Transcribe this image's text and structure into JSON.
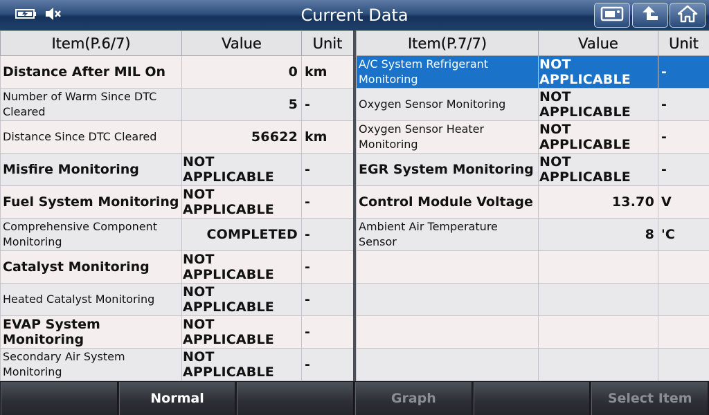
{
  "title": "Current Data",
  "icons": {
    "battery": "battery-icon",
    "speaker": "speaker-mute-icon",
    "snapshot": "snapshot-icon",
    "back": "back-arrow-icon",
    "home": "home-icon"
  },
  "colors": {
    "titlebar": "#2f4f7c",
    "selected_row": "#1a73c8",
    "row_odd": "#f5eeee",
    "row_even": "#e9e9eb"
  },
  "left_table": {
    "headers": {
      "item": "Item(P.6/7)",
      "value": "Value",
      "unit": "Unit"
    },
    "rows": [
      {
        "item": "Distance After MIL On",
        "value": "0",
        "unit": "km"
      },
      {
        "item": "Number of Warm Since DTC Cleared",
        "value": "5",
        "unit": "-"
      },
      {
        "item": "Distance Since DTC Cleared",
        "value": "56622",
        "unit": "km"
      },
      {
        "item": "Misfire Monitoring",
        "value": "NOT APPLICABLE",
        "unit": "-"
      },
      {
        "item": "Fuel System Monitoring",
        "value": "NOT APPLICABLE",
        "unit": "-"
      },
      {
        "item": "Comprehensive Component Monitoring",
        "value": "COMPLETED",
        "unit": "-"
      },
      {
        "item": "Catalyst Monitoring",
        "value": "NOT APPLICABLE",
        "unit": "-"
      },
      {
        "item": "Heated Catalyst Monitoring",
        "value": "NOT APPLICABLE",
        "unit": "-"
      },
      {
        "item": "EVAP System Monitoring",
        "value": "NOT APPLICABLE",
        "unit": "-"
      },
      {
        "item": "Secondary Air System Monitoring",
        "value": "NOT APPLICABLE",
        "unit": "-"
      }
    ]
  },
  "right_table": {
    "headers": {
      "item": "Item(P.7/7)",
      "value": "Value",
      "unit": "Unit"
    },
    "rows": [
      {
        "item": "A/C System Refrigerant Monitoring",
        "value": "NOT APPLICABLE",
        "unit": "-"
      },
      {
        "item": "Oxygen Sensor Monitoring",
        "value": "NOT APPLICABLE",
        "unit": "-"
      },
      {
        "item": "Oxygen Sensor Heater Monitoring",
        "value": "NOT APPLICABLE",
        "unit": "-"
      },
      {
        "item": "EGR System Monitoring",
        "value": "NOT APPLICABLE",
        "unit": "-"
      },
      {
        "item": "Control Module Voltage",
        "value": "13.70",
        "unit": "V"
      },
      {
        "item": "Ambient Air Temperature Sensor",
        "value": "8",
        "unit": "'C"
      },
      {
        "item": "",
        "value": "",
        "unit": ""
      },
      {
        "item": "",
        "value": "",
        "unit": ""
      },
      {
        "item": "",
        "value": "",
        "unit": ""
      },
      {
        "item": "",
        "value": "",
        "unit": ""
      }
    ]
  },
  "bottom_bar": {
    "normal": "Normal",
    "graph": "Graph",
    "select_item": "Select Item"
  }
}
